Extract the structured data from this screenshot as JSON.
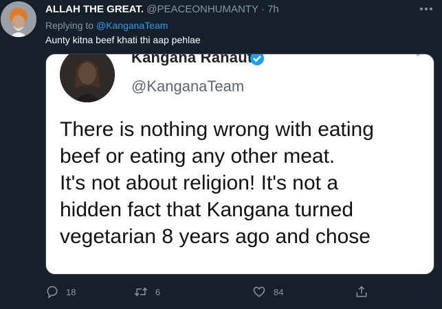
{
  "tweet": {
    "author_name": "ALLAH THE GREAT.",
    "author_handle": "@PEACEONHUMANTY",
    "separator": "·",
    "time": "7h",
    "replying_prefix": "Replying to",
    "replying_to": "@KanganaTeam",
    "text": "Aunty kitna beef khati thi aap pehlae"
  },
  "quoted_screenshot": {
    "name": "Kangana Ranaut",
    "handle": "@KanganaTeam",
    "lines": [
      "There is nothing wrong with eating",
      "beef or eating any other meat.",
      "It's not about religion! It's not a",
      "hidden fact that Kangana turned",
      "vegetarian 8 years ago and chose"
    ]
  },
  "actions": {
    "reply_count": "18",
    "retweet_count": "6",
    "like_count": "84"
  },
  "colors": {
    "background": "#15202b",
    "secondary_text": "#8899a6",
    "accent": "#1da1f2"
  },
  "icons": [
    "more-icon",
    "verified-icon",
    "chevron-down-icon",
    "reply-icon",
    "retweet-icon",
    "like-icon",
    "share-icon"
  ]
}
